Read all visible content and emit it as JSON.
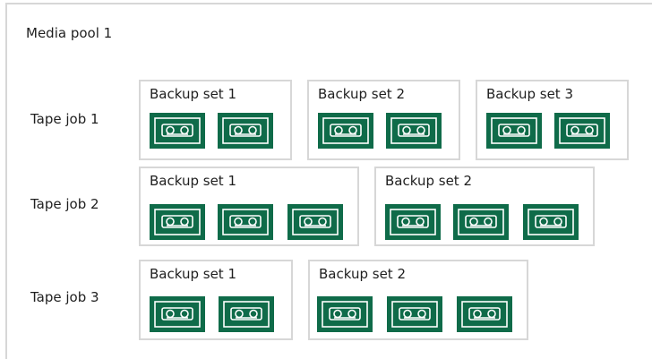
{
  "pool": {
    "title": "Media pool 1"
  },
  "jobs": [
    {
      "label": "Tape job 1",
      "sets": [
        {
          "label": "Backup set 1",
          "tapes": 2,
          "tape_icon": "tape-cartridge-icon"
        },
        {
          "label": "Backup set 2",
          "tapes": 2,
          "tape_icon": "tape-cartridge-icon"
        },
        {
          "label": "Backup set 3",
          "tapes": 2,
          "tape_icon": "tape-cartridge-icon"
        }
      ]
    },
    {
      "label": "Tape job 2",
      "sets": [
        {
          "label": "Backup set 1",
          "tapes": 3,
          "tape_icon": "tape-cartridge-icon"
        },
        {
          "label": "Backup set 2",
          "tapes": 3,
          "tape_icon": "tape-cartridge-icon"
        }
      ]
    },
    {
      "label": "Tape job 3",
      "sets": [
        {
          "label": "Backup set 1",
          "tapes": 2,
          "tape_icon": "tape-cartridge-icon"
        },
        {
          "label": "Backup set 2",
          "tapes": 3,
          "tape_icon": "tape-cartridge-icon"
        }
      ]
    }
  ],
  "colors": {
    "border": "#d7d7d7",
    "tape_fill": "#0f6b49",
    "tape_line": "#ffffff"
  }
}
